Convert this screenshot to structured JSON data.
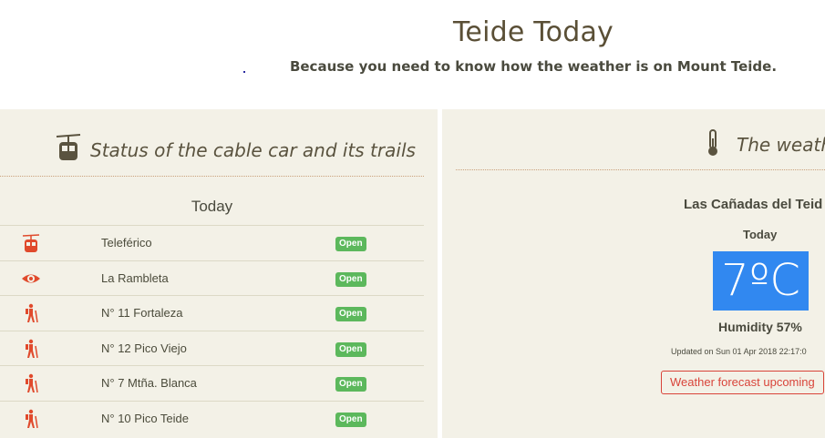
{
  "header": {
    "title": "Teide Today",
    "subtitle": "Because you need to know how the weather is on Mount Teide."
  },
  "cable_panel": {
    "title": "Status of the cable car and its trails",
    "title_icon": "cable-car-icon",
    "column_header": "Today",
    "trails": [
      {
        "icon": "cable-car-icon",
        "name": "Teleférico",
        "status": "Open"
      },
      {
        "icon": "eye-icon",
        "name": "La Rambleta",
        "status": "Open"
      },
      {
        "icon": "hiker-icon",
        "name": "N° 11 Fortaleza",
        "status": "Open"
      },
      {
        "icon": "hiker-icon",
        "name": "N° 12 Pico Viejo",
        "status": "Open"
      },
      {
        "icon": "hiker-icon",
        "name": "N° 7 Mtña. Blanca",
        "status": "Open"
      },
      {
        "icon": "hiker-icon",
        "name": "N° 10 Pico Teide",
        "status": "Open"
      }
    ],
    "colors": {
      "icon": "#e04a2c",
      "badge": "#5cb85c"
    }
  },
  "weather_panel": {
    "title": "The weathe",
    "title_icon": "thermometer-icon",
    "location": "Las Cañadas del Teid",
    "day_label": "Today",
    "temperature": "7ºC",
    "humidity": "Humidity 57%",
    "updated": "Updated on Sun 01 Apr 2018 22:17:0",
    "forecast_button": "Weather forecast upcoming",
    "colors": {
      "temp_box": "#3188f0",
      "button": "#d9443a"
    }
  }
}
